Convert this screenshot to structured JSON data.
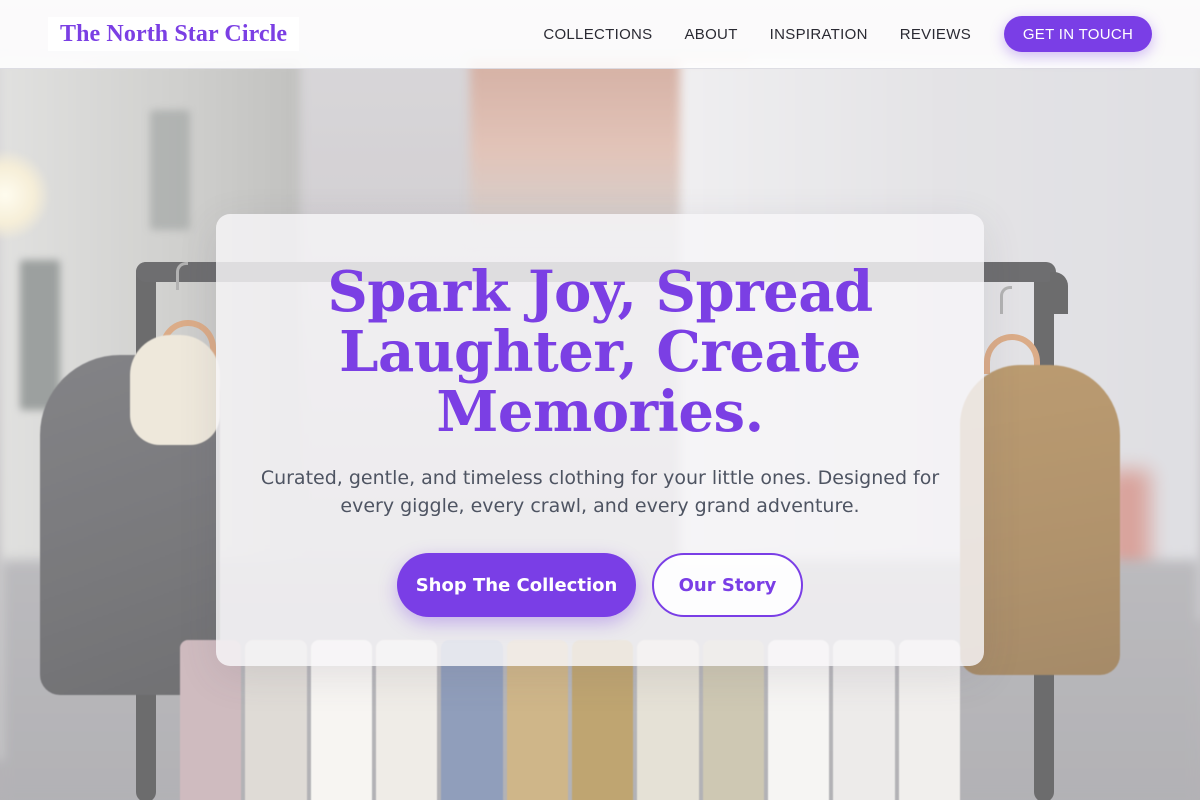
{
  "brand": {
    "name": "The North Star Circle"
  },
  "nav": {
    "items": [
      "COLLECTIONS",
      "ABOUT",
      "INSPIRATION",
      "REVIEWS"
    ],
    "cta_label": "GET IN TOUCH"
  },
  "hero": {
    "title": "Spark Joy, Spread Laughter, Create Memories.",
    "subtitle": "Curated, gentle, and timeless clothing for your little ones. Designed for every giggle, every crawl, and every grand adventure.",
    "primary_cta": "Shop The Collection",
    "secondary_cta": "Our Story",
    "background_image": "blurred clothing rack with children's garments on a street"
  },
  "colors": {
    "accent": "#7a3ee6",
    "text_dark": "#2a2a33",
    "text_muted": "#4e5462"
  }
}
